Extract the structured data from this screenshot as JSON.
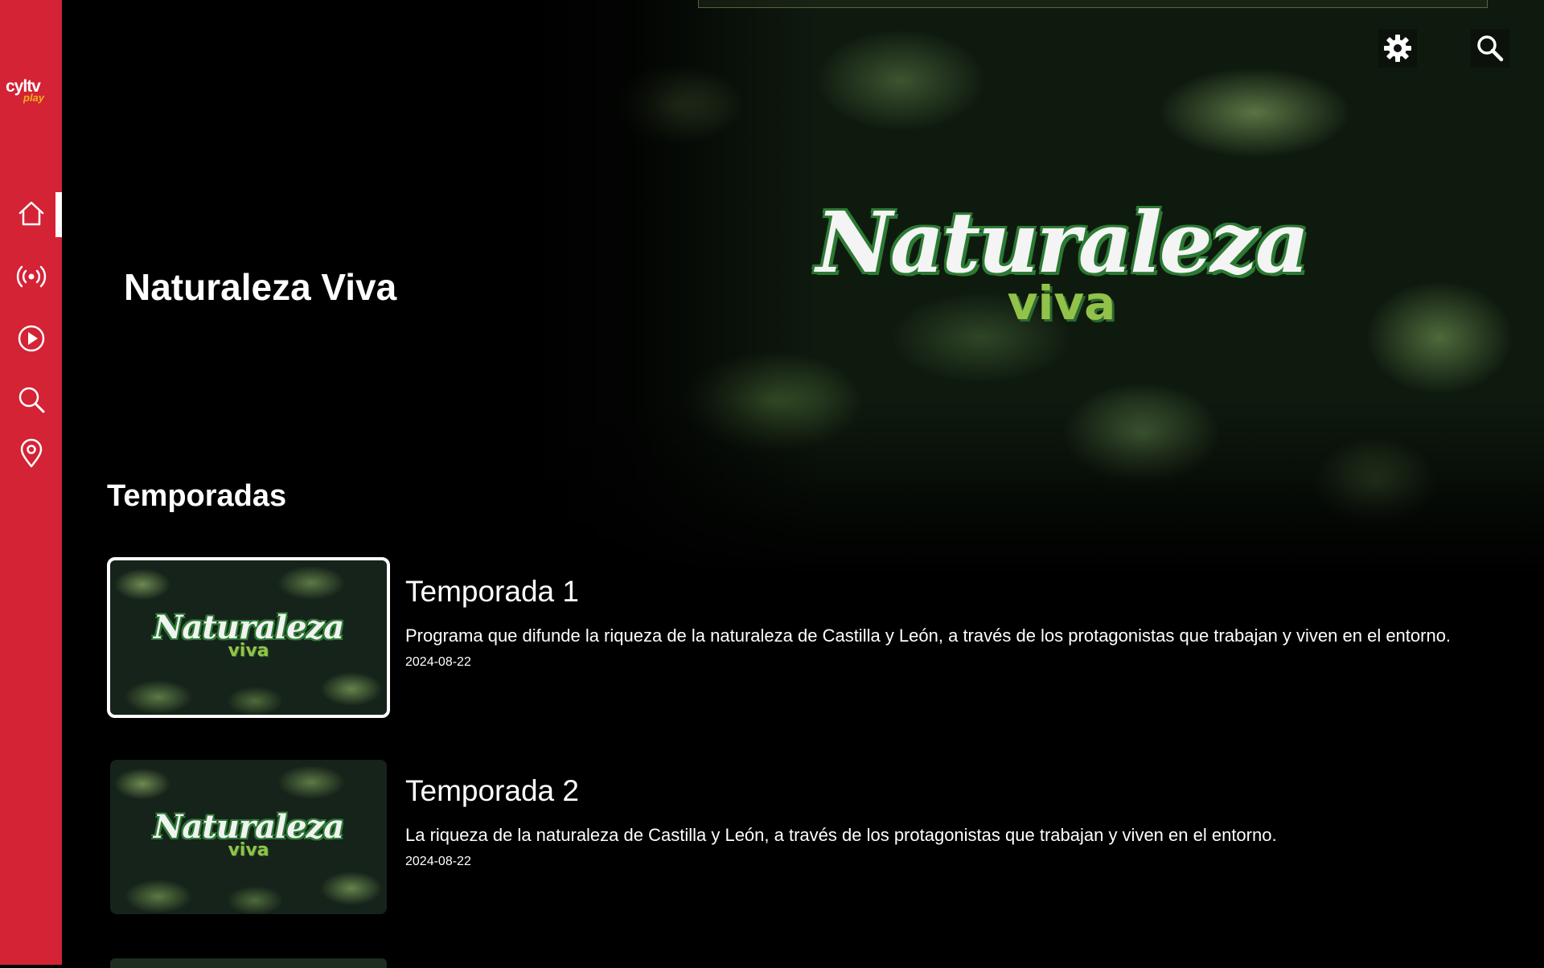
{
  "sidebar": {
    "logo_main": "cyltv",
    "logo_sub": "play",
    "items": [
      {
        "name": "home",
        "icon": "home-icon",
        "active": true
      },
      {
        "name": "live",
        "icon": "live-broadcast-icon",
        "active": false
      },
      {
        "name": "play",
        "icon": "play-circle-icon",
        "active": false
      },
      {
        "name": "search",
        "icon": "search-icon",
        "active": false
      },
      {
        "name": "location",
        "icon": "location-pin-icon",
        "active": false
      }
    ]
  },
  "header": {
    "settings_icon": "gear-icon",
    "search_icon": "search-icon"
  },
  "hero": {
    "logo_word": "Naturaleza",
    "logo_sub": "viva"
  },
  "show": {
    "title": "Naturaleza Viva"
  },
  "seasons_section": {
    "title": "Temporadas",
    "items": [
      {
        "title": "Temporada 1",
        "description": "Programa que difunde la riqueza de la naturaleza de Castilla y León, a través de los protagonistas que trabajan y viven en el entorno.",
        "date": "2024-08-22",
        "thumb_word": "Naturaleza",
        "thumb_sub": "viva",
        "focused": true
      },
      {
        "title": "Temporada 2",
        "description": "La riqueza de la naturaleza de Castilla y León, a través de los protagonistas que trabajan y viven en el entorno.",
        "date": "2024-08-22",
        "thumb_word": "Naturaleza",
        "thumb_sub": "viva",
        "focused": false
      }
    ]
  },
  "colors": {
    "sidebar_bg": "#d32335",
    "background": "#000000",
    "text": "#ffffff",
    "logo_accent": "#f3b315",
    "brand_green": "#2b7a33",
    "brand_light_green": "#93c24a"
  }
}
